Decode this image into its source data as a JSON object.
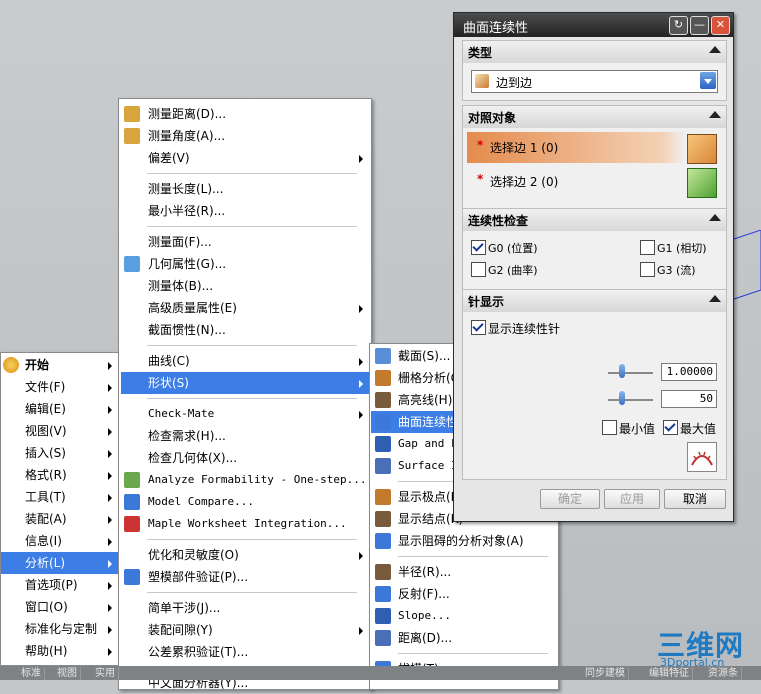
{
  "main_menu": [
    {
      "label": "开始",
      "bold": true,
      "sub": true
    },
    {
      "label": "文件(F)",
      "sub": true
    },
    {
      "label": "编辑(E)",
      "sub": true
    },
    {
      "label": "视图(V)",
      "sub": true
    },
    {
      "label": "插入(S)",
      "sub": true
    },
    {
      "label": "格式(R)",
      "sub": true
    },
    {
      "label": "工具(T)",
      "sub": true
    },
    {
      "label": "装配(A)",
      "sub": true
    },
    {
      "label": "信息(I)",
      "sub": true
    },
    {
      "label": "分析(L)",
      "sub": true,
      "highlight": true
    },
    {
      "label": "首选项(P)",
      "sub": true
    },
    {
      "label": "窗口(O)",
      "sub": true
    },
    {
      "label": "标准化与定制",
      "sub": true
    },
    {
      "label": "帮助(H)",
      "sub": true
    }
  ],
  "analysis_menu": {
    "g1": [
      "测量距离(D)...",
      "测量角度(A)...",
      "偏差(V)"
    ],
    "g2": [
      "测量长度(L)...",
      "最小半径(R)..."
    ],
    "g3": [
      "测量面(F)...",
      "几何属性(G)...",
      "测量体(B)...",
      "高级质量属性(E)",
      "截面惯性(N)..."
    ],
    "g4": [
      "曲线(C)",
      "形状(S)"
    ],
    "g5": [
      "Check-Mate",
      "检查需求(H)...",
      "检查几何体(X)...",
      "Analyze Formability - One-step...",
      "Model Compare...",
      "Maple Worksheet Integration..."
    ],
    "g6": [
      "优化和灵敏度(O)",
      "塑模部件验证(P)..."
    ],
    "g7": [
      "简单干涉(J)...",
      "装配间隙(Y)",
      "公差累积验证(T)..."
    ],
    "g8": [
      "中文面分析器(Y)..."
    ]
  },
  "shape_menu": {
    "g1": [
      "截面(S)...",
      "栅格分析(G)...",
      "高亮线(H)...",
      "曲面连续性(C)...",
      "Gap and Flushness...",
      "Surface Intersection..."
    ],
    "g2": [
      "显示极点(P)",
      "显示结点(K)",
      "显示阻碍的分析对象(A)"
    ],
    "g3": [
      "半径(R)...",
      "反射(F)...",
      "Slope...",
      "距离(D)..."
    ],
    "g4": [
      "拔模(T)..."
    ]
  },
  "dialog": {
    "title": "曲面连续性",
    "type_section": "类型",
    "type_value": "边到边",
    "ref_section": "对照对象",
    "select_edge1": "选择边 1 (0)",
    "select_edge2": "选择边 2 (0)",
    "required_mark": "*",
    "continuity_section": "连续性检查",
    "g0": "G0 (位置)",
    "g1": "G1 (相切)",
    "g2": "G2 (曲率)",
    "g3": "G3 (流)",
    "needle_section": "针显示",
    "show_needle": "显示连续性针",
    "value1": "1.00000",
    "value2": "50",
    "min_label": "最小值",
    "max_label": "最大值",
    "ok_label": "确定",
    "apply_label": "应用",
    "cancel_label": "取消"
  },
  "status_bar": [
    "标准",
    "视图",
    "实用",
    "同步建模",
    "编辑特征",
    "资源条"
  ],
  "watermark": {
    "logo": "三维网",
    "url": "3Dportal.cn"
  },
  "colors": {
    "highlight": "#3d7ee6",
    "select_active": "#e8a060",
    "accent": "#1f7ac2"
  }
}
